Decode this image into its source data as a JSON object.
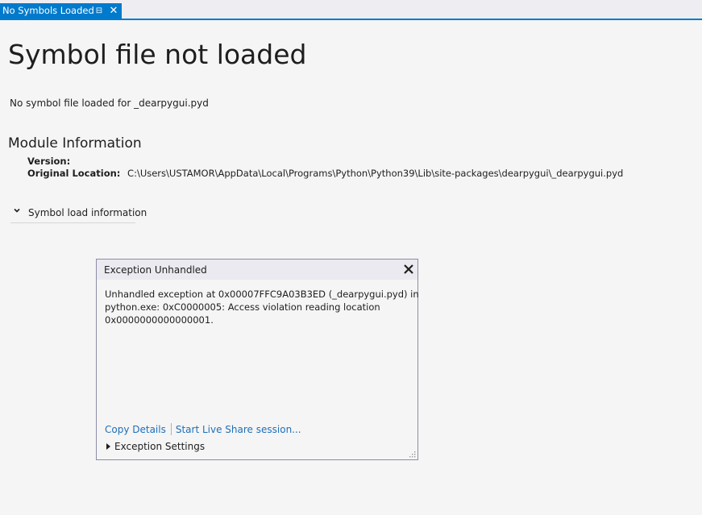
{
  "tab": {
    "label": "No Symbols Loaded",
    "pin_icon": "pin-icon",
    "close_icon": "close-icon",
    "pin_glyph": "⊟",
    "close_glyph": "✕",
    "accent": "#007acc"
  },
  "page": {
    "title": "Symbol file not loaded",
    "message": "No symbol file loaded for _dearpygui.pyd"
  },
  "module_info": {
    "heading": "Module Information",
    "version_label": "Version:",
    "version_value": "",
    "location_label": "Original Location:",
    "location_value": "C:\\Users\\USTAMOR\\AppData\\Local\\Programs\\Python\\Python39\\Lib\\site-packages\\dearpygui\\_dearpygui.pyd"
  },
  "symbol_load": {
    "label": "Symbol load information",
    "icon": "chevron-down-icon"
  },
  "exception_dialog": {
    "title": "Exception Unhandled",
    "message_lines": [
      "Unhandled exception at 0x00007FFC9A03B3ED (_dearpygui.pyd) in",
      "python.exe: 0xC0000005: Access violation reading location",
      "0x0000000000000001."
    ],
    "copy_details": "Copy Details",
    "live_share": "Start Live Share session...",
    "settings": "Exception Settings",
    "link_color": "#1e6fb8"
  }
}
